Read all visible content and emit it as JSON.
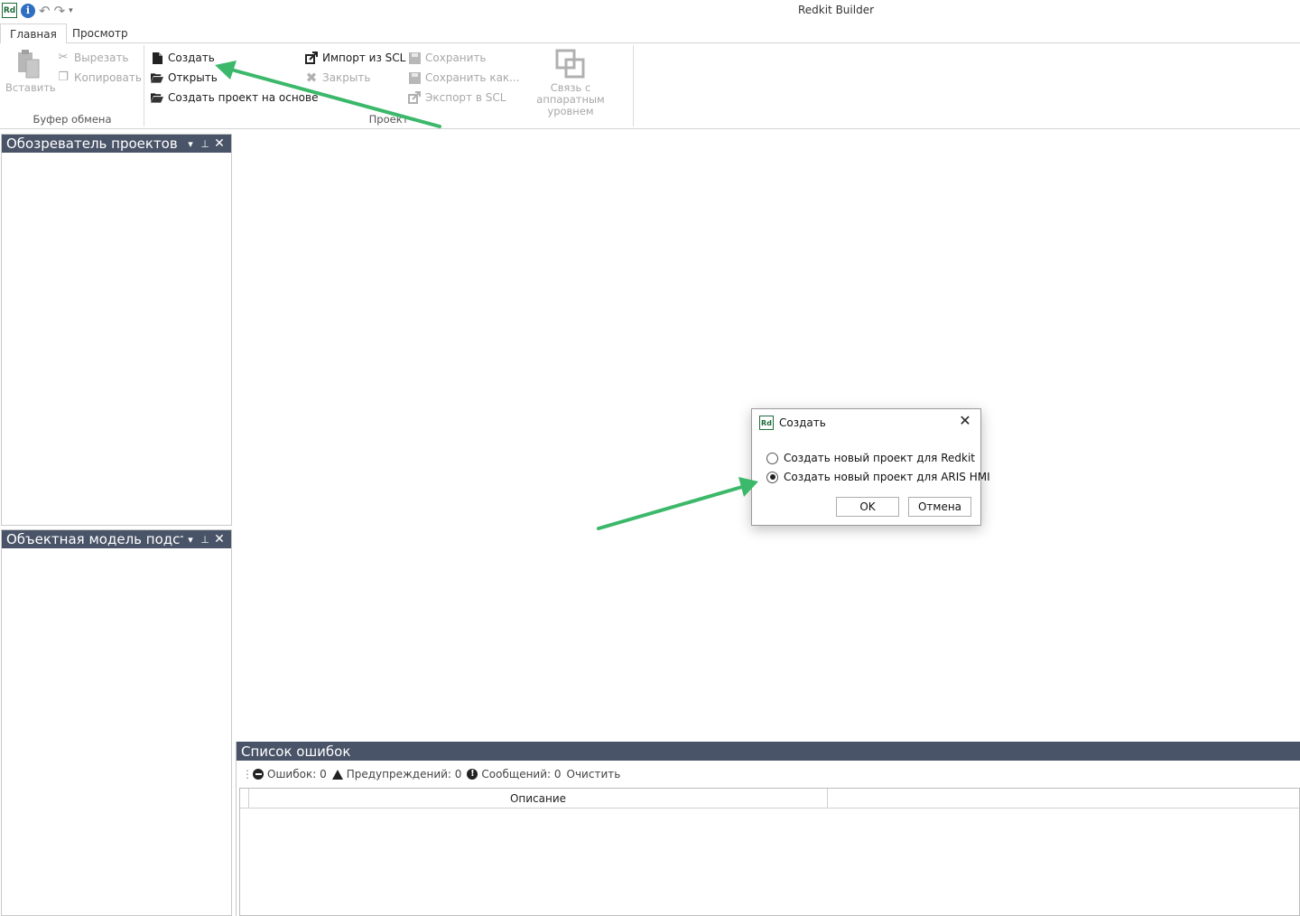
{
  "window": {
    "title": "Redkit Builder"
  },
  "qat": {
    "logo": "Rd",
    "info": "i"
  },
  "ribbon": {
    "tabs": [
      {
        "label": "Главная"
      },
      {
        "label": "Просмотр"
      }
    ],
    "clipboard": {
      "paste": "Вставить",
      "cut": "Вырезать",
      "copy": "Копировать",
      "group_label": "Буфер обмена"
    },
    "project": {
      "create": "Создать",
      "open": "Открыть",
      "create_based": "Создать проект на основе",
      "import_scl": "Импорт из SCL",
      "close": "Закрыть",
      "save": "Сохранить",
      "save_as": "Сохранить как...",
      "export_scl": "Экспорт в SCL",
      "hw_link_1": "Связь с",
      "hw_link_2": "аппаратным уровнем",
      "group_label": "Проект"
    }
  },
  "panels": {
    "project_explorer": {
      "title": "Обозреватель проектов"
    },
    "object_model": {
      "title": "Объектная модель подстанции"
    }
  },
  "errors": {
    "title": "Список ошибок",
    "errors_label": "Ошибок: 0",
    "warnings_label": "Предупреждений: 0",
    "messages_label": "Сообщений: 0",
    "clear": "Очистить",
    "columns": [
      "Описание"
    ]
  },
  "dialog": {
    "title": "Создать",
    "logo": "Rd",
    "option1": "Создать новый проект для Redkit",
    "option2": "Создать новый проект для ARIS HMI",
    "selected_option": 2,
    "ok": "OK",
    "cancel": "Отмена"
  },
  "colors": {
    "panel_header": "#4a5468",
    "annotation_arrow": "#3cb86a",
    "brand_green": "#1e6b3a"
  },
  "icons": {
    "qat": [
      "app-logo-icon",
      "info-icon",
      "undo-icon",
      "redo-icon",
      "qat-customize-icon"
    ],
    "ribbon": [
      "paste-icon",
      "cut-icon",
      "copy-icon",
      "new-file-icon",
      "folder-open-icon",
      "folder-template-icon",
      "import-icon",
      "close-x-icon",
      "save-icon",
      "save-as-icon",
      "export-icon",
      "hardware-link-icon"
    ]
  }
}
